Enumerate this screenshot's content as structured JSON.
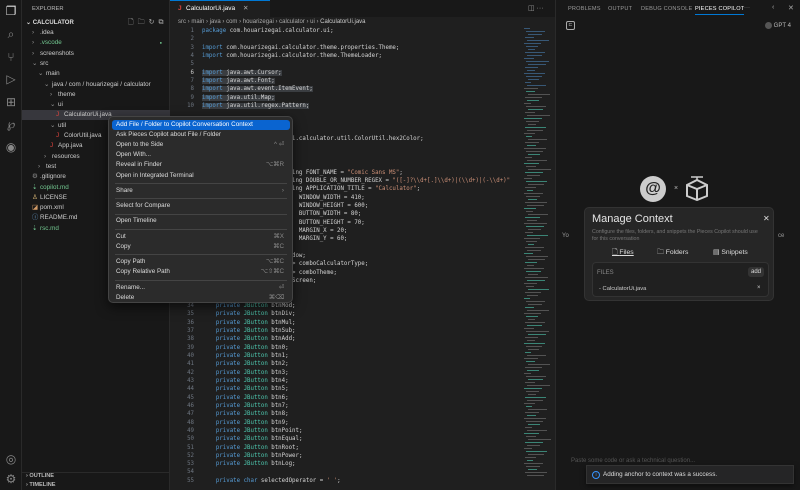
{
  "explorer": {
    "title": "EXPLORER",
    "project": "CALCULATOR",
    "tree": [
      {
        "label": ".idea",
        "icon": "chevron-right",
        "indent": 1
      },
      {
        "label": ".vscode",
        "icon": "chevron-right",
        "indent": 1,
        "color": "#73c991"
      },
      {
        "label": "screenshots",
        "icon": "chevron-right",
        "indent": 1
      },
      {
        "label": "src",
        "icon": "chevron-down",
        "indent": 1
      },
      {
        "label": "main",
        "icon": "chevron-down",
        "indent": 2
      },
      {
        "label": "java / com / houarizegai / calculator",
        "icon": "chevron-down",
        "indent": 3
      },
      {
        "label": "theme",
        "icon": "chevron-right",
        "indent": 4
      },
      {
        "label": "ui",
        "icon": "chevron-down",
        "indent": 4
      },
      {
        "label": "CalculatorUi.java",
        "icon": "java",
        "indent": 5,
        "selected": true
      },
      {
        "label": "util",
        "icon": "chevron-down",
        "indent": 4
      },
      {
        "label": "ColorUtil.java",
        "icon": "java",
        "indent": 5
      },
      {
        "label": "App.java",
        "icon": "java",
        "indent": 4
      },
      {
        "label": "resources",
        "icon": "chevron-right",
        "indent": 3
      },
      {
        "label": "test",
        "icon": "chevron-right",
        "indent": 2
      },
      {
        "label": ".gitignore",
        "icon": "gear",
        "indent": 1
      },
      {
        "label": "copilot.md",
        "icon": "md",
        "indent": 1,
        "color": "#73c991"
      },
      {
        "label": "LICENSE",
        "icon": "license",
        "indent": 1
      },
      {
        "label": "pom.xml",
        "icon": "xml",
        "indent": 1
      },
      {
        "label": "README.md",
        "icon": "info",
        "indent": 1
      },
      {
        "label": "rsc.md",
        "icon": "md",
        "indent": 1,
        "color": "#73c991"
      }
    ],
    "outline": "OUTLINE",
    "timeline": "TIMELINE"
  },
  "editor": {
    "tab": "CalculatorUi.java",
    "breadcrumb": [
      "src",
      "main",
      "java",
      "com",
      "houarizegai",
      "calculator",
      "ui",
      "CalculatorUi.java"
    ],
    "lines": [
      {
        "n": 1,
        "t": "package com.houarizegai.calculator.ui;"
      },
      {
        "n": 2,
        "t": ""
      },
      {
        "n": 3,
        "t": "import com.houarizegai.calculator.theme.properties.Theme;"
      },
      {
        "n": 4,
        "t": "import com.houarizegai.calculator.theme.ThemeLoader;"
      },
      {
        "n": 5,
        "t": ""
      },
      {
        "n": 6,
        "t": "import java.awt.Cursor;",
        "hl": true
      },
      {
        "n": 7,
        "t": "import java.awt.Font;",
        "hl": true
      },
      {
        "n": 8,
        "t": "import java.awt.event.ItemEvent;",
        "hl": true
      },
      {
        "n": 9,
        "t": "import java.util.Map;",
        "hl": true
      },
      {
        "n": 10,
        "t": "import java.util.regex.Pattern;",
        "hl": true
      },
      {
        "n": 14,
        "t": "                          i.calculator.util.ColorUtil.hex2Color;"
      },
      {
        "n": 18,
        "t": "                          ing FONT_NAME = \"Comic Sans MS\";"
      },
      {
        "n": 19,
        "t": "                          ing DOUBLE_OR_NUMBER_REGEX = \"([-]?\\\\d+[.]\\\\d+)|(\\\\d+)|(-\\\\d+)\""
      },
      {
        "n": 20,
        "t": "                          ing APPLICATION_TITLE = \"Calculator\";"
      },
      {
        "n": 21,
        "t": "                            WINDOW_WIDTH = 410;"
      },
      {
        "n": 22,
        "t": "                            WINDOW_HEIGHT = 600;"
      },
      {
        "n": 23,
        "t": "                            BUTTON_WIDTH = 80;"
      },
      {
        "n": 24,
        "t": "                            BUTTON_HEIGHT = 70;"
      },
      {
        "n": 25,
        "t": "                            MARGIN_X = 20;"
      },
      {
        "n": 26,
        "t": "                            MARGIN_Y = 60;"
      },
      {
        "n": 28,
        "t": "                          dow;"
      },
      {
        "n": 29,
        "t": "                          > comboCalculatorType;"
      },
      {
        "n": 30,
        "t": "                          > comboTheme;"
      },
      {
        "n": 31,
        "t": "                          Screen;"
      },
      {
        "n": 34,
        "t": "    private JButton btnMod;"
      },
      {
        "n": 35,
        "t": "    private JButton btnDiv;"
      },
      {
        "n": 36,
        "t": "    private JButton btnMul;"
      },
      {
        "n": 37,
        "t": "    private JButton btnSub;"
      },
      {
        "n": 38,
        "t": "    private JButton btnAdd;"
      },
      {
        "n": 39,
        "t": "    private JButton btn0;"
      },
      {
        "n": 40,
        "t": "    private JButton btn1;"
      },
      {
        "n": 41,
        "t": "    private JButton btn2;"
      },
      {
        "n": 42,
        "t": "    private JButton btn3;"
      },
      {
        "n": 43,
        "t": "    private JButton btn4;"
      },
      {
        "n": 44,
        "t": "    private JButton btn5;"
      },
      {
        "n": 45,
        "t": "    private JButton btn6;"
      },
      {
        "n": 46,
        "t": "    private JButton btn7;"
      },
      {
        "n": 47,
        "t": "    private JButton btn8;"
      },
      {
        "n": 48,
        "t": "    private JButton btn9;"
      },
      {
        "n": 49,
        "t": "    private JButton btnPoint;"
      },
      {
        "n": 50,
        "t": "    private JButton btnEqual;"
      },
      {
        "n": 51,
        "t": "    private JButton btnRoot;"
      },
      {
        "n": 52,
        "t": "    private JButton btnPower;"
      },
      {
        "n": 53,
        "t": "    private JButton btnLog;"
      },
      {
        "n": 54,
        "t": ""
      },
      {
        "n": 55,
        "t": "    private char selectedOperator = ' ';"
      }
    ]
  },
  "context_menu": {
    "items": [
      {
        "label": "Add File / Folder to Copilot Conversation Context",
        "active": true
      },
      {
        "label": "Ask Pieces Copilot about File / Folder"
      },
      {
        "label": "Open to the Side",
        "shortcut": "^ ⏎"
      },
      {
        "label": "Open With..."
      },
      {
        "label": "Reveal in Finder",
        "shortcut": "⌥⌘R"
      },
      {
        "label": "Open in Integrated Terminal",
        "sep_after": true
      },
      {
        "label": "Share",
        "shortcut": "›",
        "sep_after": true
      },
      {
        "label": "Select for Compare",
        "sep_after": true
      },
      {
        "label": "Open Timeline",
        "sep_after": true
      },
      {
        "label": "Cut",
        "shortcut": "⌘X"
      },
      {
        "label": "Copy",
        "shortcut": "⌘C",
        "sep_after": true
      },
      {
        "label": "Copy Path",
        "shortcut": "⌥⌘C"
      },
      {
        "label": "Copy Relative Path",
        "shortcut": "⌥⇧⌘C",
        "sep_after": true
      },
      {
        "label": "Rename...",
        "shortcut": "⏎"
      },
      {
        "label": "Delete",
        "shortcut": "⌘⌫"
      }
    ]
  },
  "panel": {
    "tabs": [
      "PROBLEMS",
      "OUTPUT",
      "DEBUG CONSOLE",
      "PIECES COPILOT"
    ],
    "active_tab": "PIECES COPILOT",
    "more": "···",
    "model": "GPT 4",
    "bg_text_left": "Yo",
    "bg_text_right": "ce",
    "dialog": {
      "title": "Manage Context",
      "description": "Configure the files, folders, and snippets the Pieces Copilot should use for this conversation",
      "tabs": [
        "Files",
        "Folders",
        "Snippets"
      ],
      "section": "FILES",
      "add_label": "add",
      "files": [
        "CalculatorUi.java"
      ]
    },
    "input_placeholder": "Paste some code or ask a technical question...",
    "toast": "Adding anchor to context was a success."
  },
  "colors": {
    "accent": "#0078d4",
    "menu_highlight": "#0a64d0",
    "java": "#e0443e",
    "git_added": "#73c991"
  }
}
